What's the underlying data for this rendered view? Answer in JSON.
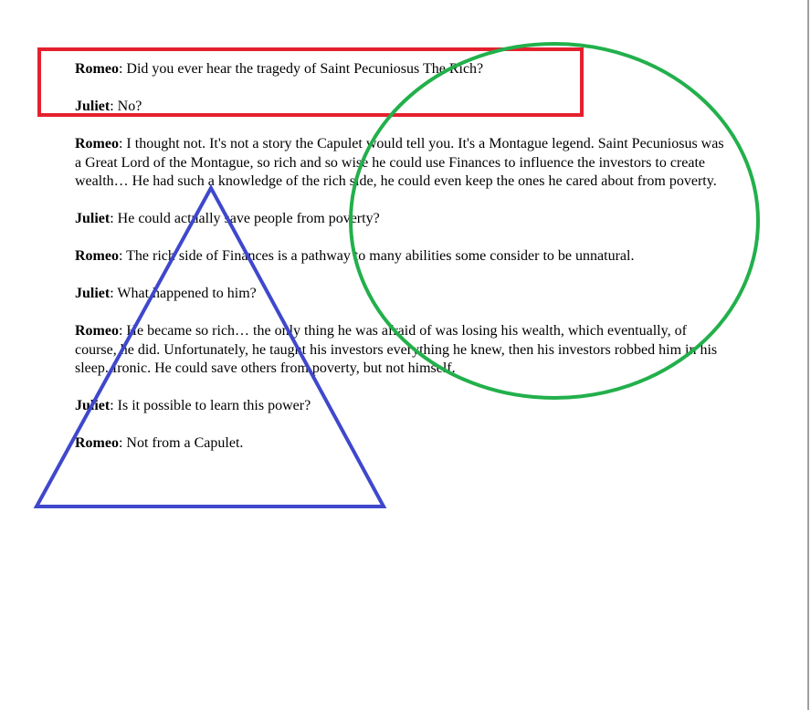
{
  "dialogue": [
    {
      "speaker": "Romeo",
      "text": ": Did you ever hear the tragedy of Saint Pecuniosus The Rich?"
    },
    {
      "speaker": "Juliet",
      "text": ": No?"
    },
    {
      "speaker": "Romeo",
      "text": ": I thought not. It's not a story the Capulet would tell you. It's a Montague legend. Saint Pecuniosus was a Great Lord of the Montague, so rich and so wise he could use Finances to influence the investors to create wealth… He had such a knowledge of the rich side, he could even keep the ones he cared about from poverty."
    },
    {
      "speaker": "Juliet",
      "text": ": He could actually save people from poverty?"
    },
    {
      "speaker": "Romeo",
      "text": ": The rich side of Finances is a pathway to many abilities some consider to be unnatural."
    },
    {
      "speaker": "Juliet",
      "text": ": What happened to him?"
    },
    {
      "speaker": "Romeo",
      "text": ": He became so rich… the only thing he was afraid of was losing his wealth, which eventually, of course, he did. Unfortunately, he taught his investors everything he knew, then his investors robbed him in his sleep. Ironic. He could save others from poverty, but not himself."
    },
    {
      "speaker": "Juliet",
      "text": ": Is it possible to learn this power?"
    },
    {
      "speaker": "Romeo",
      "text": ": Not from a Capulet."
    }
  ],
  "annotations": {
    "rectangle_color": "#e5202e",
    "ellipse_color": "#22b04b",
    "triangle_color": "#3f48cc"
  }
}
